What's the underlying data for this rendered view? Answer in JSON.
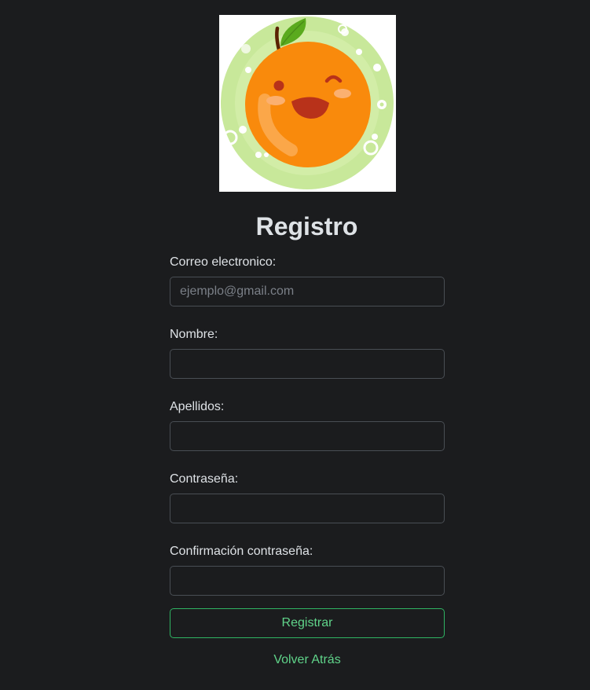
{
  "logo": {
    "icon": "smiling-orange-icon"
  },
  "form": {
    "title": "Registro",
    "fields": [
      {
        "label": "Correo electronico:",
        "placeholder": "ejemplo@gmail.com",
        "value": ""
      },
      {
        "label": "Nombre:",
        "placeholder": "",
        "value": ""
      },
      {
        "label": "Apellidos:",
        "placeholder": "",
        "value": ""
      },
      {
        "label": "Contraseña:",
        "placeholder": "",
        "value": ""
      },
      {
        "label": "Confirmación contraseña:",
        "placeholder": "",
        "value": ""
      }
    ],
    "submit_label": "Registrar",
    "back_label": "Volver Atrás"
  },
  "colors": {
    "background": "#1b1c1e",
    "accent": "#60d48a",
    "accent_border": "#2fb463",
    "input_border": "#494e54"
  }
}
